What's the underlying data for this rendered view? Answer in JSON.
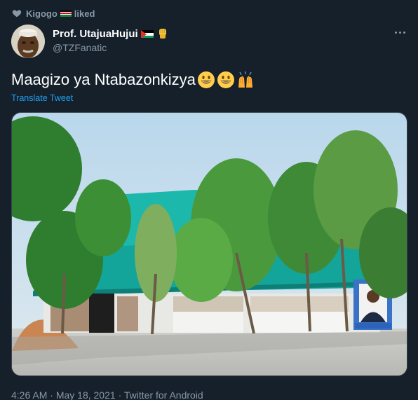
{
  "social_context": {
    "icon": "heart-icon",
    "liker_name": "Kigogo",
    "liker_flag": "kenya-flag-icon",
    "action": "liked"
  },
  "author": {
    "display_name": "Prof. UtajuaHujui",
    "handle": "@TZFanatic",
    "name_badges": [
      "palestine-flag-icon",
      "raised-fist-icon"
    ]
  },
  "tweet": {
    "text": "Maagizo ya Ntabazonkizya",
    "emojis": [
      "grinning-face-icon",
      "grinning-face-icon",
      "raising-hands-icon"
    ],
    "translate_label": "Translate Tweet"
  },
  "media": {
    "description_icon": "photo-building-icon"
  },
  "meta": {
    "time": "4:26 AM",
    "separator": "·",
    "date": "May 18, 2021",
    "source": "Twitter for Android"
  },
  "colors": {
    "background": "#15202b",
    "secondary_text": "#8899a6",
    "link": "#1da1f2",
    "roof": "#14a59a"
  }
}
